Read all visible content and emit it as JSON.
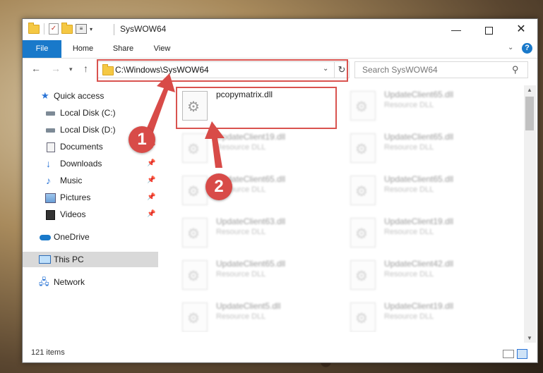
{
  "window": {
    "title": "SysWOW64",
    "minimize": "—",
    "close": "✕"
  },
  "ribbon": {
    "tabs": [
      "File",
      "Home",
      "Share",
      "View"
    ],
    "help": "?"
  },
  "nav": {
    "address": "C:\\Windows\\SysWOW64",
    "search_placeholder": "Search SysWOW64"
  },
  "sidebar": {
    "items": [
      {
        "label": "Quick access",
        "icon": "star-icon"
      },
      {
        "label": "Local Disk (C:)",
        "icon": "disk-icon"
      },
      {
        "label": "Local Disk (D:)",
        "icon": "disk-icon"
      },
      {
        "label": "Documents",
        "icon": "documents-icon",
        "pinned": true
      },
      {
        "label": "Downloads",
        "icon": "download-icon",
        "pinned": true
      },
      {
        "label": "Music",
        "icon": "music-icon",
        "pinned": true
      },
      {
        "label": "Pictures",
        "icon": "pictures-icon",
        "pinned": true
      },
      {
        "label": "Videos",
        "icon": "videos-icon",
        "pinned": true
      },
      {
        "label": "OneDrive",
        "icon": "cloud-icon"
      },
      {
        "label": "This PC",
        "icon": "computer-icon",
        "selected": true
      },
      {
        "label": "Network",
        "icon": "network-icon"
      }
    ]
  },
  "files": {
    "left": [
      {
        "name": "pcopymatrix.dll",
        "type": "",
        "blurred": false
      },
      {
        "name": "UpdateClient19.dll",
        "type": "Resource DLL",
        "blurred": true
      },
      {
        "name": "UpdateClient65.dll",
        "type": "Resource DLL",
        "blurred": true
      },
      {
        "name": "UpdateClient63.dll",
        "type": "Resource DLL",
        "blurred": true
      },
      {
        "name": "UpdateClient65.dll",
        "type": "Resource DLL",
        "blurred": true
      },
      {
        "name": "UpdateClient5.dll",
        "type": "Resource DLL",
        "blurred": true
      }
    ],
    "right": [
      {
        "name": "UpdateClient65.dll",
        "type": "Resource DLL",
        "blurred": true
      },
      {
        "name": "UpdateClient65.dll",
        "type": "Resource DLL",
        "blurred": true
      },
      {
        "name": "UpdateClient65.dll",
        "type": "Resource DLL",
        "blurred": true
      },
      {
        "name": "UpdateClient19.dll",
        "type": "Resource DLL",
        "blurred": true
      },
      {
        "name": "UpdateClient42.dll",
        "type": "Resource DLL",
        "blurred": true
      },
      {
        "name": "UpdateClient19.dll",
        "type": "Resource DLL",
        "blurred": true
      }
    ]
  },
  "status": {
    "count": "121 items"
  },
  "annotations": {
    "step1": "1",
    "step2": "2",
    "color": "#d84b48"
  }
}
